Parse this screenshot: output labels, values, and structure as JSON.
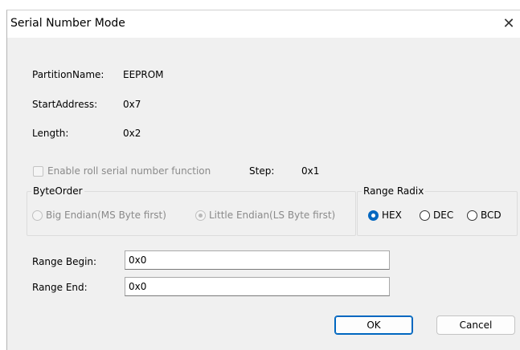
{
  "window": {
    "title": "Serial Number Mode",
    "close_icon": "close-icon"
  },
  "info": {
    "partition_label": "PartitionName:",
    "partition_value": "EEPROM",
    "start_label": "StartAddress:",
    "start_value": "0x7",
    "length_label": "Length:",
    "length_value": "0x2"
  },
  "roll": {
    "label": "Enable roll serial number function",
    "checked": false,
    "step_label": "Step:",
    "step_value": "0x1"
  },
  "byte_order": {
    "title": "ByteOrder",
    "options": [
      "Big Endian(MS Byte first)",
      "Little Endian(LS Byte first)"
    ],
    "selected": "Little Endian(LS Byte first)"
  },
  "range_radix": {
    "title": "Range Radix",
    "options": [
      "HEX",
      "DEC",
      "BCD"
    ],
    "selected": "HEX"
  },
  "range": {
    "begin_label": "Range Begin:",
    "begin_value": "0x0",
    "end_label": "Range End:",
    "end_value": "0x0"
  },
  "buttons": {
    "ok_label": "OK",
    "cancel_label": "Cancel"
  },
  "colors": {
    "accent": "#0067c0",
    "dialog_bg": "#f0f0f0"
  }
}
